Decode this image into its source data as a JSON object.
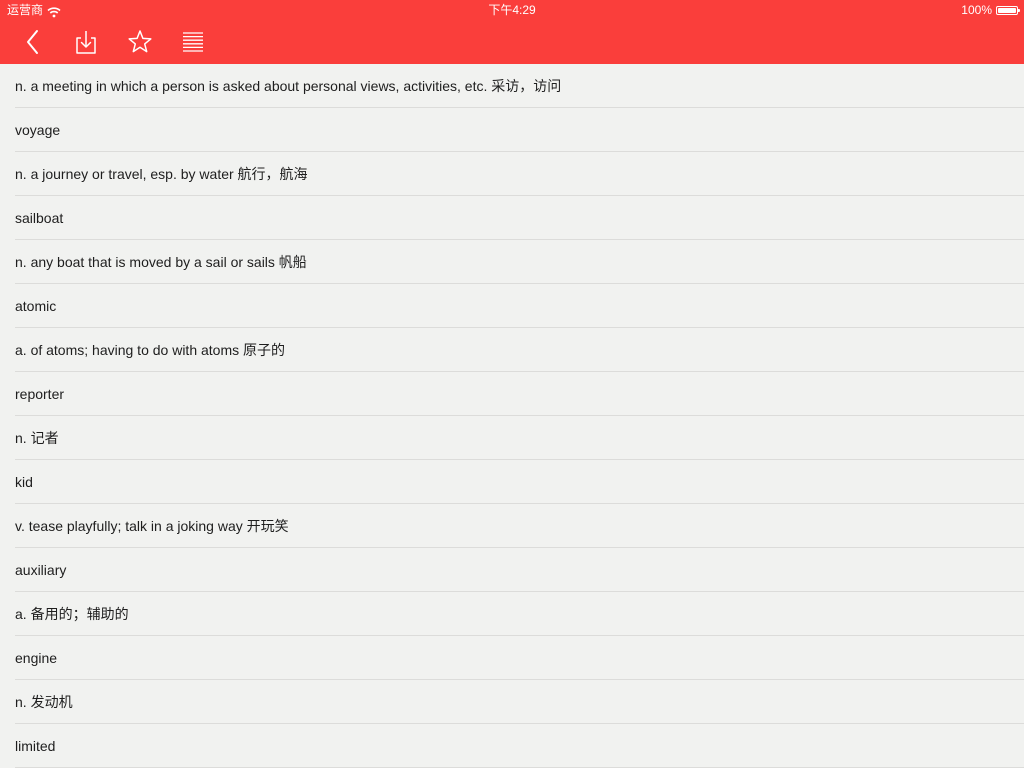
{
  "status_bar": {
    "carrier": "运营商",
    "time": "下午4:29",
    "battery": "100%"
  },
  "toolbar": {
    "icons": [
      "back-chevron-icon",
      "download-icon",
      "star-icon",
      "menu-lines-icon"
    ]
  },
  "colors": {
    "accent": "#fa3e3b",
    "background": "#f1f2f0",
    "divider": "#dcdcda",
    "text": "#1e1e1e"
  },
  "entries": [
    "n. a meeting in which a person is asked about personal views, activities, etc. 采访，访问",
    "voyage",
    "n. a journey or travel, esp. by water 航行，航海",
    "sailboat",
    "n. any boat that is moved by a sail or sails 帆船",
    "atomic",
    "a. of atoms; having to do with atoms 原子的",
    "reporter",
    "n. 记者",
    "kid",
    "v. tease playfully; talk in a joking way 开玩笑",
    "auxiliary",
    "a. 备用的；辅助的",
    "engine",
    "n. 发动机",
    "limited"
  ]
}
